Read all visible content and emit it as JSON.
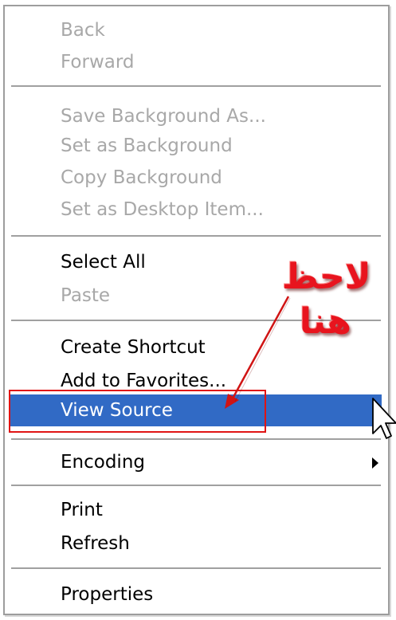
{
  "context_menu": {
    "items": [
      {
        "label": "Back",
        "enabled": false
      },
      {
        "label": "Forward",
        "enabled": false
      },
      {
        "label": "Save Background As...",
        "enabled": false
      },
      {
        "label": "Set as Background",
        "enabled": false
      },
      {
        "label": "Copy Background",
        "enabled": false
      },
      {
        "label": "Set as Desktop Item...",
        "enabled": false
      },
      {
        "label": "Select All",
        "enabled": true
      },
      {
        "label": "Paste",
        "enabled": false
      },
      {
        "label": "Create Shortcut",
        "enabled": true
      },
      {
        "label": "Add to Favorites...",
        "enabled": true
      },
      {
        "label": "View Source",
        "enabled": true,
        "selected": true
      },
      {
        "label": "Encoding",
        "enabled": true,
        "has_submenu": true
      },
      {
        "label": "Print",
        "enabled": true
      },
      {
        "label": "Refresh",
        "enabled": true
      },
      {
        "label": "Properties",
        "enabled": true
      }
    ]
  },
  "annotation": {
    "line1": "لاحظ",
    "line2": "هنا",
    "color": "#e8141e"
  },
  "colors": {
    "selection": "#316ac5",
    "disabled_text": "#a8a8a8",
    "highlight_box": "#e01414"
  }
}
